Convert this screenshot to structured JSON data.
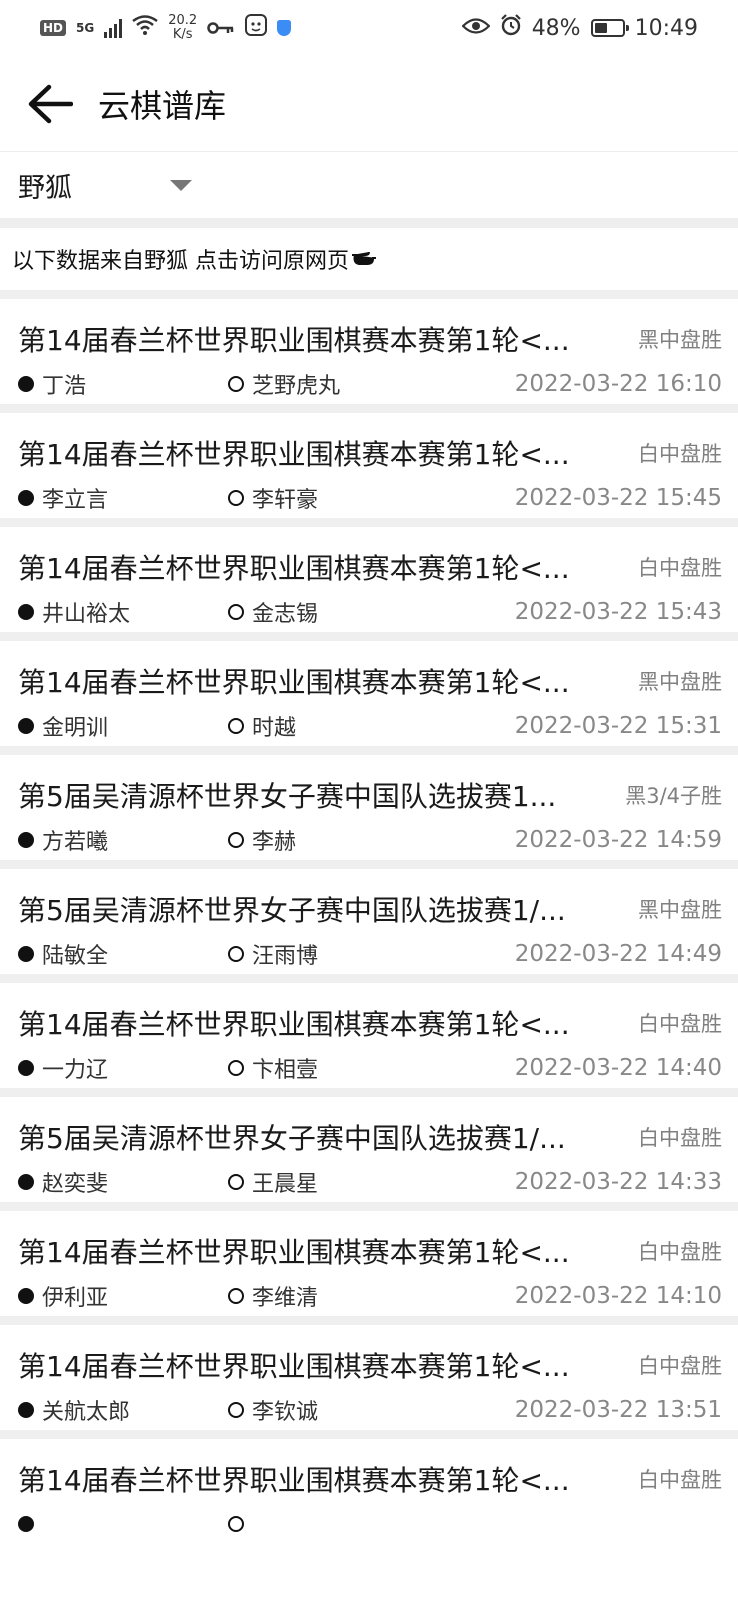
{
  "status_bar": {
    "network_badge": "HD",
    "network_type": "5G",
    "speed_value": "20.2",
    "speed_unit": "K/s",
    "battery_percent": "48%",
    "battery_level": 0.48,
    "time": "10:49"
  },
  "app_bar": {
    "title": "云棋谱库"
  },
  "source": {
    "selected": "野狐",
    "note": "以下数据来自野狐 点击访问原网页"
  },
  "games": [
    {
      "title": "第14届春兰杯世界职业围棋赛本赛第1轮<...",
      "result": "黑中盘胜",
      "black": "丁浩",
      "white": "芝野虎丸",
      "date": "2022-03-22 16:10"
    },
    {
      "title": "第14届春兰杯世界职业围棋赛本赛第1轮<...",
      "result": "白中盘胜",
      "black": "李立言",
      "white": "李轩豪",
      "date": "2022-03-22 15:45"
    },
    {
      "title": "第14届春兰杯世界职业围棋赛本赛第1轮<...",
      "result": "白中盘胜",
      "black": "井山裕太",
      "white": "金志锡",
      "date": "2022-03-22 15:43"
    },
    {
      "title": "第14届春兰杯世界职业围棋赛本赛第1轮<...",
      "result": "黑中盘胜",
      "black": "金明训",
      "white": "时越",
      "date": "2022-03-22 15:31"
    },
    {
      "title": "第5届吴清源杯世界女子赛中国队选拔赛1...",
      "result": "黑3/4子胜",
      "black": "方若曦",
      "white": "李赫",
      "date": "2022-03-22 14:59"
    },
    {
      "title": "第5届吴清源杯世界女子赛中国队选拔赛1/...",
      "result": "黑中盘胜",
      "black": "陆敏全",
      "white": "汪雨博",
      "date": "2022-03-22 14:49"
    },
    {
      "title": "第14届春兰杯世界职业围棋赛本赛第1轮<...",
      "result": "白中盘胜",
      "black": "一力辽",
      "white": "卞相壹",
      "date": "2022-03-22 14:40"
    },
    {
      "title": "第5届吴清源杯世界女子赛中国队选拔赛1/...",
      "result": "白中盘胜",
      "black": "赵奕斐",
      "white": "王晨星",
      "date": "2022-03-22 14:33"
    },
    {
      "title": "第14届春兰杯世界职业围棋赛本赛第1轮<...",
      "result": "白中盘胜",
      "black": "伊利亚",
      "white": "李维清",
      "date": "2022-03-22 14:10"
    },
    {
      "title": "第14届春兰杯世界职业围棋赛本赛第1轮<...",
      "result": "白中盘胜",
      "black": "关航太郎",
      "white": "李钦诚",
      "date": "2022-03-22 13:51"
    },
    {
      "title": "第14届春兰杯世界职业围棋赛本赛第1轮<...",
      "result": "白中盘胜",
      "black": "",
      "white": "",
      "date": ""
    }
  ]
}
